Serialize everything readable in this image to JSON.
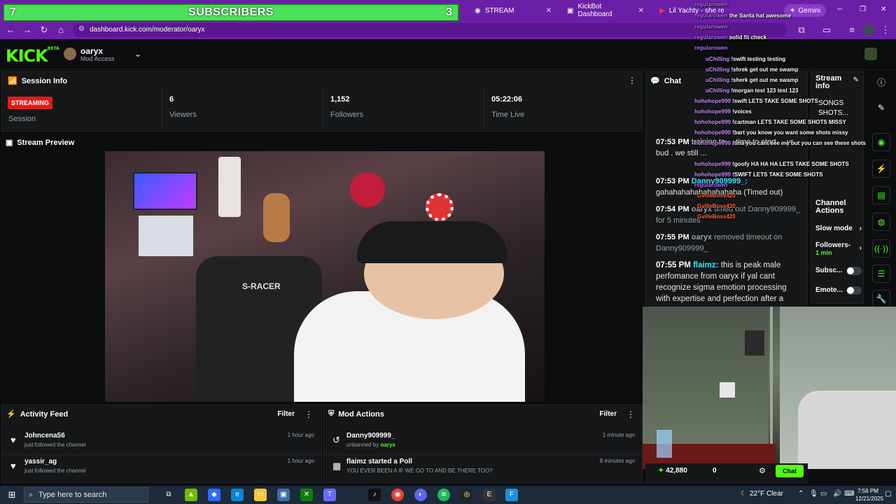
{
  "browser": {
    "tabs": [
      {
        "label": "STREAM"
      },
      {
        "label": "KickBot Dashboard"
      },
      {
        "label": "Lil Yachty - she ready (..."
      }
    ],
    "gemini_label": "Gemini",
    "url": "dashboard.kick.com/moderator/oaryx"
  },
  "overlay": {
    "subs_left": "7",
    "subs_title": "SUBSCRIBERS",
    "subs_right": "3",
    "chat_lines": [
      {
        "user": "regularowen",
        "text": ""
      },
      {
        "user": "regularowen",
        "text": "the Santa hat awesome"
      },
      {
        "user": "regularowen",
        "text": ""
      },
      {
        "user": "regularowen",
        "text": "solid fit check"
      },
      {
        "user": "regularowen",
        "text": ""
      },
      {
        "user": "uChilling",
        "text": "!swift testing testing"
      },
      {
        "user": "uChilling",
        "text": "!shrek get out me swamp"
      },
      {
        "user": "uChilling",
        "text": "!sherk get out me swamp"
      },
      {
        "user": "uChilling",
        "text": "!morgan test 123 test 123"
      },
      {
        "user": "hohohope999",
        "text": "!swift LETS TAKE SOME SHOTS"
      },
      {
        "user": "hohohope999",
        "text": "!voices"
      },
      {
        "user": "hohohope999",
        "text": "!cartman LETS TAKE SOME SHOTS MISSY"
      },
      {
        "user": "hohohope999",
        "text": "!bart you know you want some shots missy"
      },
      {
        "user": "hohohope999",
        "text": "!tina you cant see me but you can see these shots"
      },
      {
        "user": "hohohope999",
        "text": "!goofy HA HA HA LETS TAKE SOME SHOTS"
      },
      {
        "user": "hohohope999",
        "text": "!SWIFT LETS TAKE SOME SHOTS"
      },
      {
        "user": "regularowen",
        "text": ""
      },
      {
        "user": "GvilleBoss420",
        "text": ""
      },
      {
        "user": "GvilleBoss420",
        "text": ""
      },
      {
        "user": "GvilleBoss420",
        "text": ""
      }
    ]
  },
  "header": {
    "logo": "KICK",
    "logo_beta": "BETA",
    "username": "oaryx",
    "role": "Mod Access"
  },
  "session": {
    "title": "Session Info",
    "badge": "STREAMING",
    "stats": [
      {
        "value": "",
        "label": "Session"
      },
      {
        "value": "6",
        "label": "Viewers"
      },
      {
        "value": "1,152",
        "label": "Followers"
      },
      {
        "value": "05:22:06",
        "label": "Time Live"
      }
    ]
  },
  "preview": {
    "title": "Stream Preview",
    "chair_brand": "S-RACER"
  },
  "activity": {
    "title": "Activity Feed",
    "filter": "Filter",
    "items": [
      {
        "name": "Johncena56",
        "sub": "just followed the channel",
        "time": "1 hour ago"
      },
      {
        "name": "yassir_ag",
        "sub": "just followed the channel",
        "time": "1 hour ago"
      }
    ]
  },
  "mod_actions": {
    "title": "Mod Actions",
    "filter": "Filter",
    "items": [
      {
        "name": "Danny909999_",
        "sub_prefix": "unbanned by",
        "sub_user": "oaryx",
        "time": "1 minute ago"
      },
      {
        "name": "flaimz started a Poll",
        "sub": "YOU EVER BEEN A IF WE GO TO AND BE THERE TOO?",
        "time": "8 minutes ago"
      }
    ]
  },
  "chat": {
    "title": "Chat",
    "messages": [
      {
        "time": "07:53 PM",
        "user": "",
        "text": "training to ... time to start ... yr bud . we still ..."
      },
      {
        "time": "07:53 PM",
        "user": "Danny909999_:",
        "text": "gahahahahahahahahaha (Timed out)"
      },
      {
        "time": "07:54 PM",
        "user": "oaryx",
        "text": "timed out Danny909999_ for 5 minutes"
      },
      {
        "time": "07:55 PM",
        "user": "oaryx",
        "text": "removed timeout on Danny909999_"
      },
      {
        "time": "07:55 PM",
        "user": "flaimz:",
        "text": "this is peak male perfomance from oaryx if yal cant recognize sigma emotion processing with expertise and perfection after a"
      }
    ],
    "footer": {
      "points": "42,880",
      "count": "0",
      "button": "Chat"
    }
  },
  "stream_info": {
    "title": "Stream info",
    "value": "SONGS SHOTS...",
    "actions_title": "Channel Actions",
    "actions": [
      {
        "label": "Slow mode"
      },
      {
        "label": "Followers-",
        "sub": "1 min"
      },
      {
        "label": "Subsc..."
      },
      {
        "label": "Emote..."
      }
    ]
  },
  "taskbar": {
    "search_placeholder": "Type here to search",
    "weather": "22°F  Clear",
    "time": "7:56 PM",
    "date": "12/21/2025"
  }
}
